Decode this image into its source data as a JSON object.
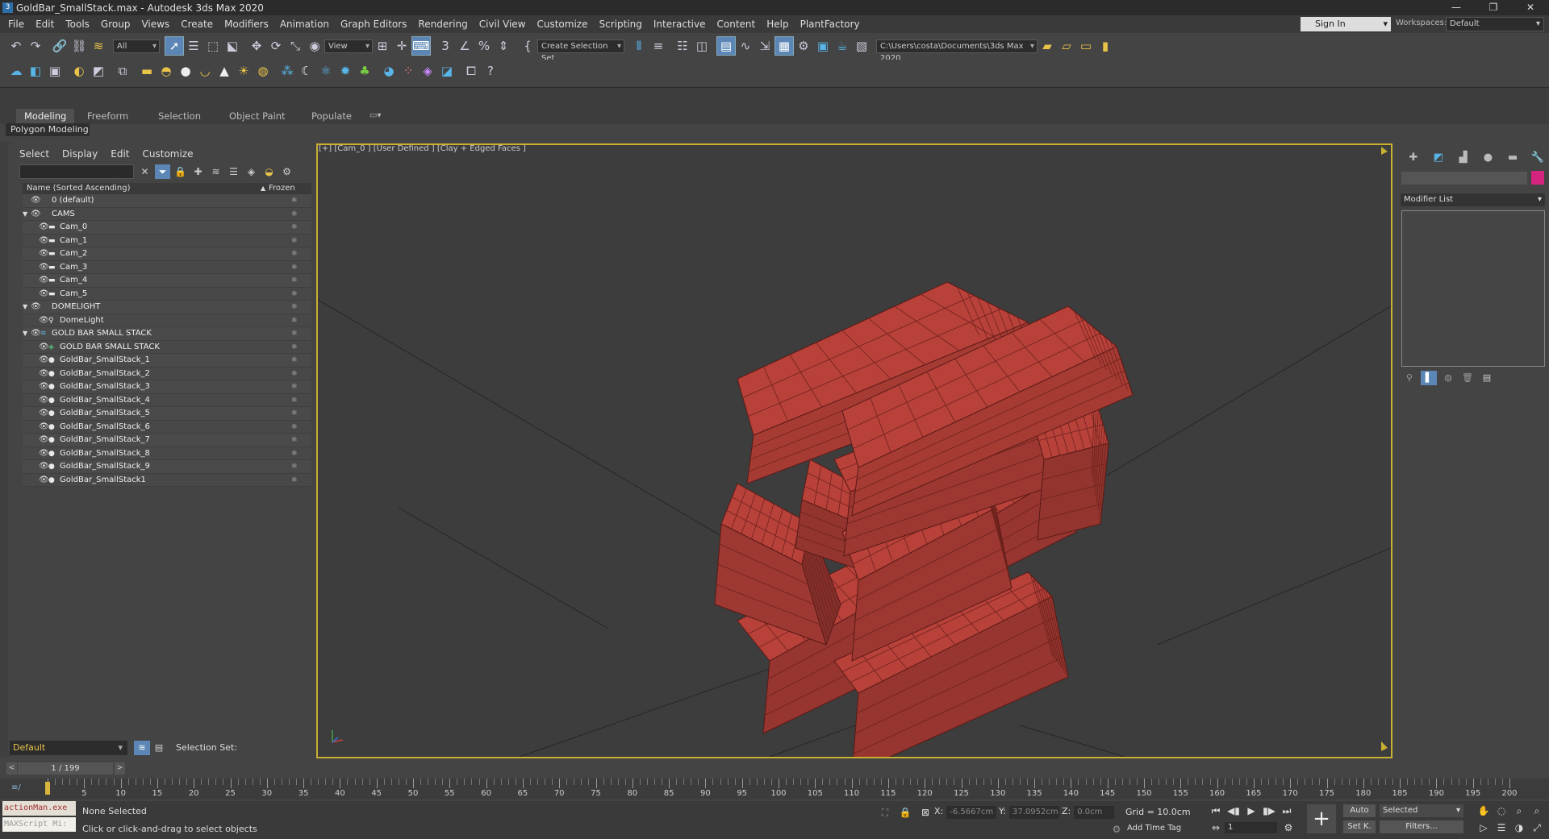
{
  "window": {
    "title": "GoldBar_SmallStack.max - Autodesk 3ds Max 2020",
    "app_icon": "3"
  },
  "menu": [
    "File",
    "Edit",
    "Tools",
    "Group",
    "Views",
    "Create",
    "Modifiers",
    "Animation",
    "Graph Editors",
    "Rendering",
    "Civil View",
    "Customize",
    "Scripting",
    "Interactive",
    "Content",
    "Help",
    "PlantFactory"
  ],
  "account": {
    "sign_in": "Sign In",
    "workspaces_label": "Workspaces:",
    "workspace": "Default"
  },
  "toolbar": {
    "selection_filter": "All",
    "ref_coord": "View",
    "create_selection_set": "Create Selection Set",
    "project_path": "C:\\Users\\costa\\Documents\\3ds Max 2020"
  },
  "ribbon": {
    "tabs": [
      "Modeling",
      "Freeform",
      "Selection",
      "Object Paint",
      "Populate"
    ],
    "active": "Modeling",
    "sub": "Polygon Modeling"
  },
  "explorer": {
    "tabs": [
      "Select",
      "Display",
      "Edit",
      "Customize"
    ],
    "column_name": "Name (Sorted Ascending)",
    "column_frozen": "Frozen",
    "rows": [
      {
        "label": "0 (default)",
        "level": 0,
        "type": "layer"
      },
      {
        "label": "CAMS",
        "level": 0,
        "type": "layer",
        "expanded": true
      },
      {
        "label": "Cam_0",
        "level": 1,
        "type": "camera"
      },
      {
        "label": "Cam_1",
        "level": 1,
        "type": "camera"
      },
      {
        "label": "Cam_2",
        "level": 1,
        "type": "camera"
      },
      {
        "label": "Cam_3",
        "level": 1,
        "type": "camera"
      },
      {
        "label": "Cam_4",
        "level": 1,
        "type": "camera"
      },
      {
        "label": "Cam_5",
        "level": 1,
        "type": "camera"
      },
      {
        "label": "DOMELIGHT",
        "level": 0,
        "type": "layer",
        "expanded": true
      },
      {
        "label": "DomeLight",
        "level": 1,
        "type": "light"
      },
      {
        "label": "GOLD BAR SMALL STACK",
        "level": 0,
        "type": "layer",
        "expanded": true
      },
      {
        "label": "GOLD BAR SMALL STACK",
        "level": 1,
        "type": "group"
      },
      {
        "label": "GoldBar_SmallStack_1",
        "level": 1,
        "type": "object"
      },
      {
        "label": "GoldBar_SmallStack_2",
        "level": 1,
        "type": "object"
      },
      {
        "label": "GoldBar_SmallStack_3",
        "level": 1,
        "type": "object"
      },
      {
        "label": "GoldBar_SmallStack_4",
        "level": 1,
        "type": "object"
      },
      {
        "label": "GoldBar_SmallStack_5",
        "level": 1,
        "type": "object"
      },
      {
        "label": "GoldBar_SmallStack_6",
        "level": 1,
        "type": "object"
      },
      {
        "label": "GoldBar_SmallStack_7",
        "level": 1,
        "type": "object"
      },
      {
        "label": "GoldBar_SmallStack_8",
        "level": 1,
        "type": "object"
      },
      {
        "label": "GoldBar_SmallStack_9",
        "level": 1,
        "type": "object"
      },
      {
        "label": "GoldBar_SmallStack1",
        "level": 1,
        "type": "object"
      }
    ],
    "layer": "Default",
    "selection_set_label": "Selection Set:"
  },
  "frame_counter": "1 / 199",
  "timeline": {
    "ticks": [
      5,
      10,
      15,
      20,
      25,
      30,
      35,
      40,
      45,
      50,
      55,
      60,
      65,
      70,
      75,
      80,
      85,
      90,
      95,
      100,
      105,
      110,
      115,
      120,
      125,
      130,
      135,
      140,
      145,
      150,
      155,
      160,
      165,
      170,
      175,
      180,
      185,
      190,
      195,
      200
    ],
    "max": 200,
    "current": 1
  },
  "viewport": {
    "label": "[+] [Cam_0 ] [User Defined ] [Clay + Edged Faces ]",
    "bar_color": "#b8413a"
  },
  "status": {
    "maxscript_line1": "actionMan.exe",
    "maxscript_line2": "MAXScript Mi:",
    "selected": "None Selected",
    "hint": "Click or click-and-drag to select objects",
    "x_label": "X:",
    "x": "-6.5667cm",
    "y_label": "Y:",
    "y": "37.0952cm",
    "z_label": "Z:",
    "z": "0.0cm",
    "grid": "Grid = 10.0cm",
    "add_time_tag": "Add Time Tag",
    "auto": "Auto",
    "set_key": "Set K.",
    "selected_dropdown": "Selected",
    "filters": "Filters...",
    "frame": "1"
  },
  "command_panel": {
    "modifier_list": "Modifier List",
    "object_color": "#d4247e"
  }
}
